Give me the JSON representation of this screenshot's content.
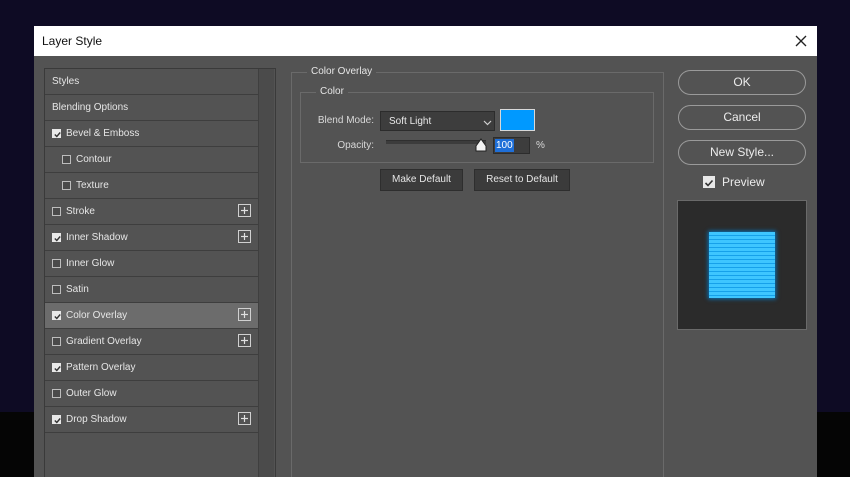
{
  "dialog": {
    "title": "Layer Style"
  },
  "styles_panel": {
    "items": [
      {
        "label": "Styles",
        "checkbox": false,
        "checked": false,
        "plus": false,
        "selected": false,
        "indent": 0
      },
      {
        "label": "Blending Options",
        "checkbox": false,
        "checked": false,
        "plus": false,
        "selected": false,
        "indent": 0
      },
      {
        "label": "Bevel & Emboss",
        "checkbox": true,
        "checked": true,
        "plus": false,
        "selected": false,
        "indent": 0
      },
      {
        "label": "Contour",
        "checkbox": true,
        "checked": false,
        "plus": false,
        "selected": false,
        "indent": 1
      },
      {
        "label": "Texture",
        "checkbox": true,
        "checked": false,
        "plus": false,
        "selected": false,
        "indent": 1
      },
      {
        "label": "Stroke",
        "checkbox": true,
        "checked": false,
        "plus": true,
        "selected": false,
        "indent": 0
      },
      {
        "label": "Inner Shadow",
        "checkbox": true,
        "checked": true,
        "plus": true,
        "selected": false,
        "indent": 0
      },
      {
        "label": "Inner Glow",
        "checkbox": true,
        "checked": false,
        "plus": false,
        "selected": false,
        "indent": 0
      },
      {
        "label": "Satin",
        "checkbox": true,
        "checked": false,
        "plus": false,
        "selected": false,
        "indent": 0
      },
      {
        "label": "Color Overlay",
        "checkbox": true,
        "checked": true,
        "plus": true,
        "selected": true,
        "indent": 0
      },
      {
        "label": "Gradient Overlay",
        "checkbox": true,
        "checked": false,
        "plus": true,
        "selected": false,
        "indent": 0
      },
      {
        "label": "Pattern Overlay",
        "checkbox": true,
        "checked": true,
        "plus": false,
        "selected": false,
        "indent": 0
      },
      {
        "label": "Outer Glow",
        "checkbox": true,
        "checked": false,
        "plus": false,
        "selected": false,
        "indent": 0
      },
      {
        "label": "Drop Shadow",
        "checkbox": true,
        "checked": true,
        "plus": true,
        "selected": false,
        "indent": 0
      }
    ]
  },
  "color_overlay": {
    "section_title": "Color Overlay",
    "group_title": "Color",
    "blend_mode_label": "Blend Mode:",
    "blend_mode_value": "Soft Light",
    "overlay_color": "#0099ff",
    "opacity_label": "Opacity:",
    "opacity_value": "100",
    "opacity_fraction": 1.0,
    "opacity_unit": "%",
    "make_default_label": "Make Default",
    "reset_default_label": "Reset to Default"
  },
  "actions": {
    "ok_label": "OK",
    "cancel_label": "Cancel",
    "new_style_label": "New Style...",
    "preview_label": "Preview",
    "preview_checked": true
  },
  "icons": {
    "close": "close-icon",
    "add": "plus-icon",
    "check": "checkmark-icon",
    "dropdown": "chevron-down-icon",
    "slider": "slider-thumb-icon"
  },
  "colors": {
    "dialog_bg": "#535353",
    "selected_row": "#6c6c6c",
    "selection_highlight": "#1f6fd8",
    "preview_color": "#3ec6ff"
  }
}
